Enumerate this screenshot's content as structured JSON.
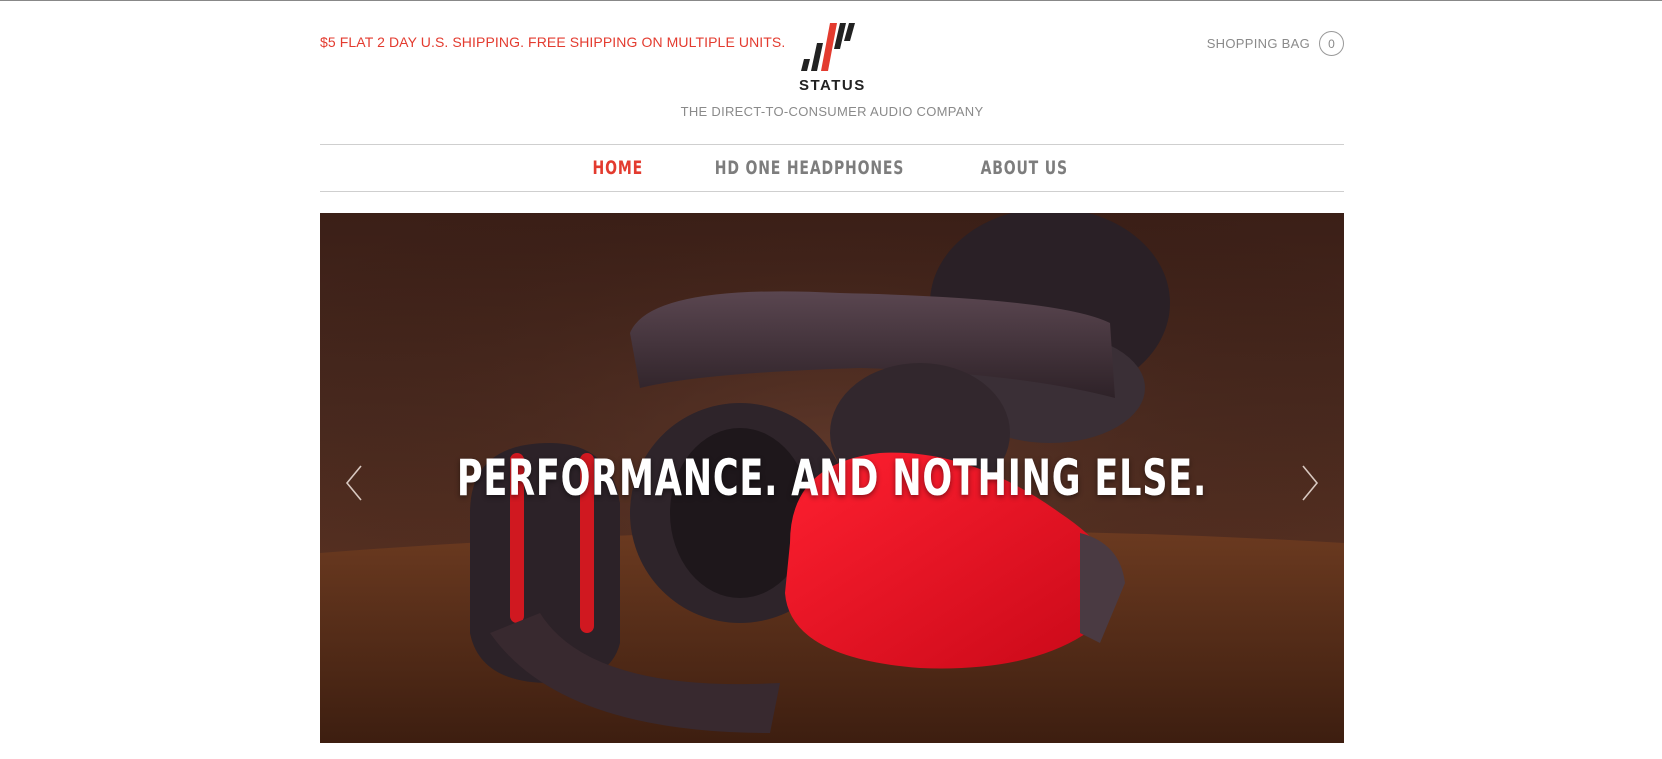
{
  "header": {
    "promo": "$5 FLAT 2 DAY U.S. SHIPPING. FREE SHIPPING ON MULTIPLE UNITS.",
    "logo_text": "STATUS",
    "tagline": "THE DIRECT-TO-CONSUMER AUDIO COMPANY",
    "bag_label": "SHOPPING BAG",
    "bag_count": "0"
  },
  "nav": {
    "items": [
      {
        "label": "HOME",
        "active": true
      },
      {
        "label": "HD ONE HEADPHONES",
        "active": false
      },
      {
        "label": "ABOUT US",
        "active": false
      }
    ]
  },
  "hero": {
    "headline": "PERFORMANCE. AND NOTHING ELSE.",
    "prev_icon": "chevron-left-icon",
    "next_icon": "chevron-right-icon"
  },
  "colors": {
    "accent": "#e33b2f",
    "muted_text": "#8a8a8a",
    "logo_dark": "#222222"
  }
}
